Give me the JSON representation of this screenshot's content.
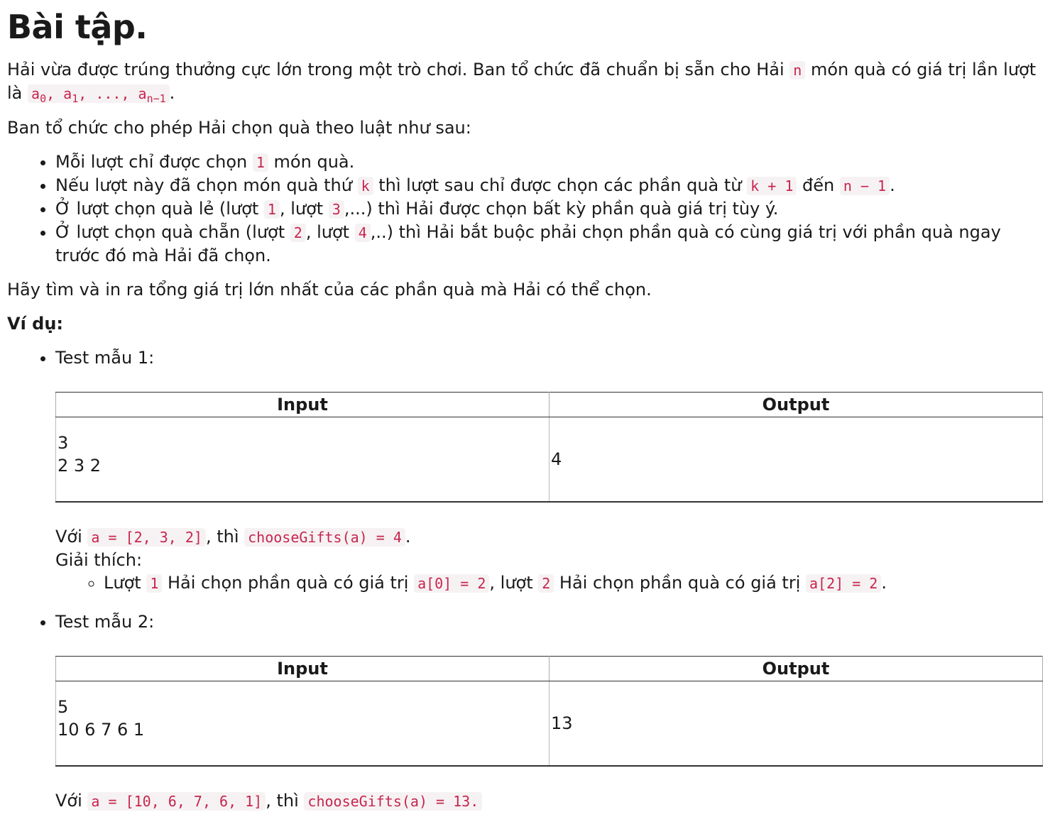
{
  "title": "Bài tập.",
  "intro": {
    "text_before_n": "Hải vừa được trúng thưởng cực lớn trong một trò chơi. Ban tổ chức đã chuẩn bị sẵn cho Hải ",
    "n": "n",
    "text_after_n": " món quà có giá trị lần lượt là ",
    "array_a0": "a",
    "array_sub0": "0",
    "array_sep1": ", a",
    "array_sub1": "1",
    "array_sep2": ", ..., a",
    "array_subn": "n−1",
    "text_end": "."
  },
  "rules_intro": "Ban tổ chức cho phép Hải chọn quà theo luật như sau:",
  "rules": {
    "r1_a": "Mỗi lượt chỉ được chọn ",
    "r1_code": "1",
    "r1_b": " món quà.",
    "r2_a": "Nếu lượt này đã chọn món quà thứ ",
    "r2_code1": "k",
    "r2_b": " thì lượt sau chỉ được chọn các phần quà từ ",
    "r2_code2": " k + 1",
    "r2_c": " đến ",
    "r2_code3": "n − 1",
    "r2_d": ".",
    "r3_a": "Ở lượt chọn quà lẻ (lượt ",
    "r3_code1": "1",
    "r3_b": ", lượt ",
    "r3_code2": "3",
    "r3_c": ",...) thì Hải được chọn bất kỳ phần quà giá trị tùy ý.",
    "r4_a": "Ở lượt chọn quà chẵn (lượt ",
    "r4_code1": "2",
    "r4_b": ", lượt ",
    "r4_code2": "4",
    "r4_c": ",..) thì Hải bắt buộc phải chọn phần quà có cùng giá trị với phần quà ngay trước đó mà Hải đã chọn."
  },
  "task": "Hãy tìm và in ra tổng giá trị lớn nhất của các phần quà mà Hải có thể chọn.",
  "example_label": "Ví dụ:",
  "tests": [
    {
      "title": "Test mẫu 1:",
      "header_input": "Input",
      "header_output": "Output",
      "input_line1": "3",
      "input_line2": "2 3 2",
      "output": "4",
      "with_text": "Với ",
      "with_code": "a = [2, 3, 2]",
      "then_text": ", thì ",
      "result_code": "chooseGifts(a) = 4",
      "end_text": ".",
      "explain_label": "Giải thích:",
      "explain": {
        "a": "Lượt ",
        "code1": "1",
        "b": " Hải chọn phần quà có giá trị ",
        "code2": "a[0] = 2",
        "c": ", lượt ",
        "code3": "2",
        "d": " Hải chọn phần quà có giá trị ",
        "code4": "a[2] = 2",
        "e": "."
      }
    },
    {
      "title": "Test mẫu 2:",
      "header_input": "Input",
      "header_output": "Output",
      "input_line1": "5",
      "input_line2": "10 6 7 6 1",
      "output": "13",
      "with_text": "Với ",
      "with_code": "a = [10, 6, 7, 6, 1]",
      "then_text": ", thì ",
      "result_code": "chooseGifts(a) = 13."
    }
  ]
}
